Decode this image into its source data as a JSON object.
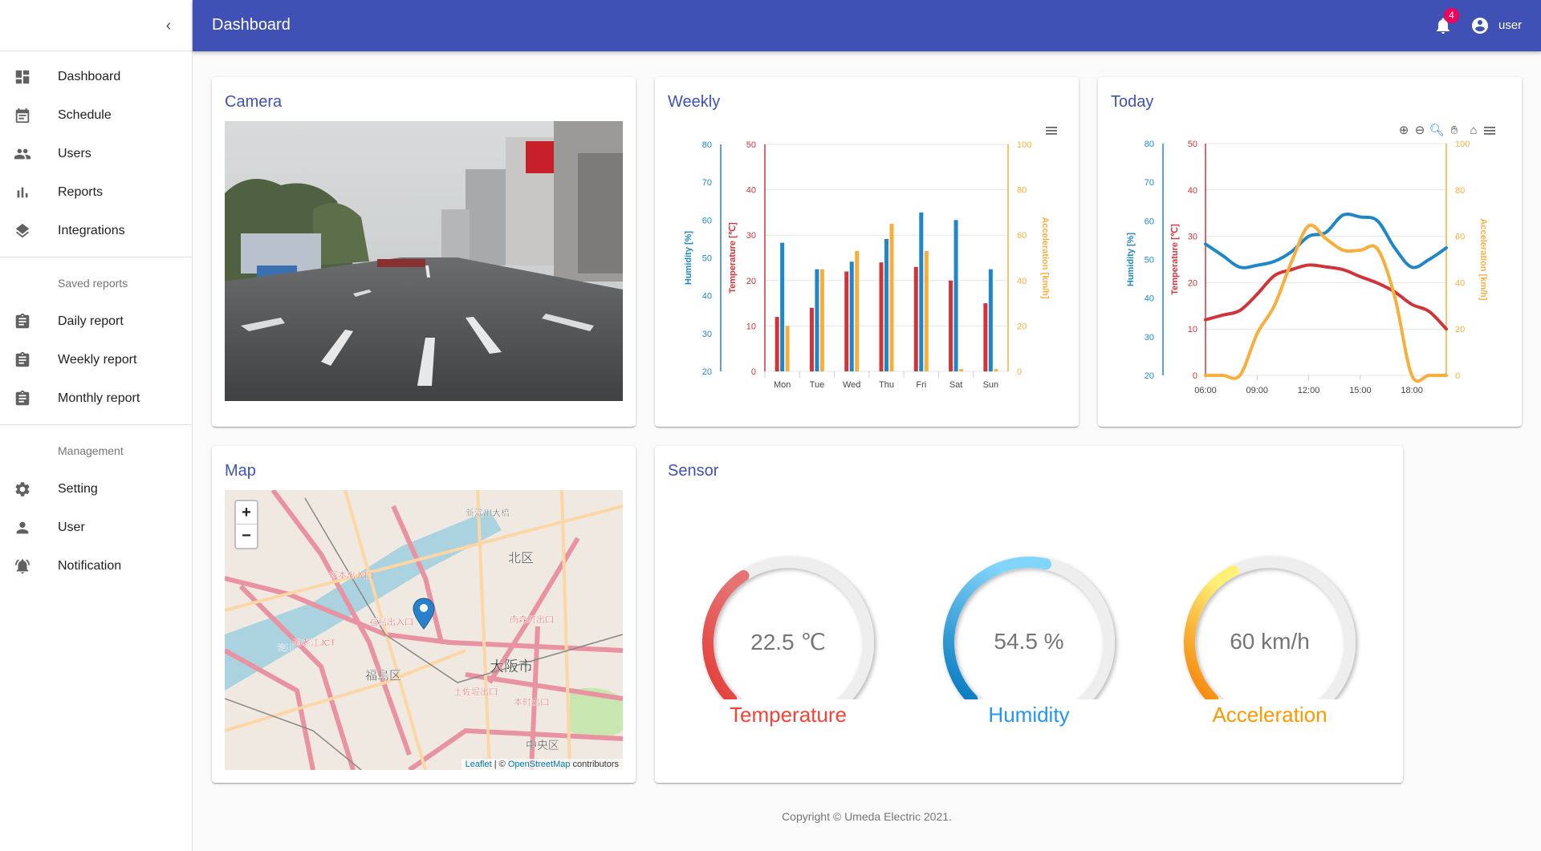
{
  "header": {
    "title": "Dashboard",
    "notification_count": "4",
    "user": "user"
  },
  "sidebar": {
    "main": [
      {
        "label": "Dashboard",
        "icon": "dashboard-icon"
      },
      {
        "label": "Schedule",
        "icon": "calendar-icon"
      },
      {
        "label": "Users",
        "icon": "people-icon"
      },
      {
        "label": "Reports",
        "icon": "bar-chart-icon"
      },
      {
        "label": "Integrations",
        "icon": "layers-icon"
      }
    ],
    "saved_title": "Saved reports",
    "saved": [
      {
        "label": "Daily report",
        "icon": "clipboard-icon"
      },
      {
        "label": "Weekly report",
        "icon": "clipboard-icon"
      },
      {
        "label": "Monthly report",
        "icon": "clipboard-icon"
      }
    ],
    "management_title": "Management",
    "management": [
      {
        "label": "Setting",
        "icon": "gear-icon"
      },
      {
        "label": "User",
        "icon": "person-icon"
      },
      {
        "label": "Notification",
        "icon": "notification-bell-icon"
      }
    ]
  },
  "cards": {
    "camera": "Camera",
    "weekly": "Weekly",
    "today": "Today",
    "map": "Map",
    "sensor": "Sensor"
  },
  "map": {
    "zoom_in": "+",
    "zoom_out": "−",
    "attribution_leaflet": "Leaflet",
    "attribution_sep": " | © ",
    "attribution_osm": "OpenStreetMap",
    "attribution_tail": " contributors",
    "labels": [
      "北区",
      "大阪市",
      "福島区",
      "中央区",
      "塚本出入口",
      "福島出入口",
      "海老江JCT",
      "新淀川大橋",
      "南森町出口",
      "土佐堀出口",
      "本町出口",
      "淀川"
    ]
  },
  "colors": {
    "primary": "#3f51b5",
    "temperature": "#d13438",
    "humidity": "#1f87c8",
    "acceleration": "#f7ae3a"
  },
  "chart_data": [
    {
      "type": "bar",
      "title": "",
      "categories": [
        "Mon",
        "Tue",
        "Wed",
        "Thu",
        "Fri",
        "Sat",
        "Sun"
      ],
      "axes": {
        "humidity": {
          "label": "Humidity [%]",
          "range": [
            20,
            80
          ],
          "ticks": [
            20,
            30,
            40,
            50,
            60,
            70,
            80
          ]
        },
        "temperature": {
          "label": "Temperature [℃]",
          "range": [
            0,
            50
          ],
          "ticks": [
            0,
            10,
            20,
            30,
            40,
            50
          ]
        },
        "acceleration": {
          "label": "Acceleration [km/h]",
          "range": [
            0,
            100
          ],
          "ticks": [
            0,
            20,
            40,
            60,
            80,
            100
          ]
        }
      },
      "series": [
        {
          "name": "Temperature",
          "axis": "temperature",
          "values": [
            12,
            14,
            22,
            24,
            23,
            20,
            15
          ]
        },
        {
          "name": "Humidity",
          "axis": "humidity",
          "values": [
            54,
            47,
            49,
            55,
            62,
            60,
            47
          ]
        },
        {
          "name": "Acceleration",
          "axis": "acceleration",
          "values": [
            20,
            45,
            53,
            65,
            53,
            1,
            1
          ]
        }
      ],
      "grid": true
    },
    {
      "type": "line",
      "title": "",
      "x": [
        "06:00",
        "07:00",
        "08:00",
        "09:00",
        "10:00",
        "11:00",
        "12:00",
        "13:00",
        "14:00",
        "15:00",
        "16:00",
        "17:00",
        "18:00",
        "19:00",
        "20:00"
      ],
      "xticks": [
        "06:00",
        "09:00",
        "12:00",
        "15:00",
        "18:00"
      ],
      "axes": {
        "humidity": {
          "label": "Humidity [%]",
          "range": [
            20,
            80
          ],
          "ticks": [
            20,
            30,
            40,
            50,
            60,
            70,
            80
          ]
        },
        "temperature": {
          "label": "Temperature [℃]",
          "range": [
            0,
            50
          ],
          "ticks": [
            0,
            10,
            20,
            30,
            40,
            50
          ]
        },
        "acceleration": {
          "label": "Acceleration [km/h]",
          "range": [
            0,
            100
          ],
          "ticks": [
            0,
            20,
            40,
            60,
            80,
            100
          ]
        }
      },
      "series": [
        {
          "name": "Humidity",
          "axis": "humidity",
          "values": [
            54,
            51,
            48,
            48.5,
            49.5,
            52,
            56,
            57,
            61.5,
            61,
            60,
            53,
            48,
            50,
            53
          ]
        },
        {
          "name": "Temperature",
          "axis": "temperature",
          "values": [
            12,
            13,
            14,
            17.5,
            21.5,
            22.8,
            23.8,
            23.4,
            22.8,
            21.3,
            19.9,
            18,
            15.3,
            13.8,
            10
          ]
        },
        {
          "name": "Acceleration",
          "axis": "acceleration",
          "values": [
            0,
            0,
            0,
            18,
            30,
            49,
            64.5,
            59,
            54,
            54,
            54.5,
            34,
            0,
            0,
            0
          ]
        }
      ],
      "grid": true
    }
  ],
  "gauges": [
    {
      "label": "Temperature",
      "value": "22.5 ℃",
      "fill_fraction": 0.375,
      "c1": "#e53935",
      "c2": "#e57373",
      "label_color": "#f44336"
    },
    {
      "label": "Humidity",
      "value": "54.5 %",
      "fill_fraction": 0.545,
      "c1": "#0277bd",
      "c2": "#81d4fa",
      "label_color": "#2196f3"
    },
    {
      "label": "Acceleration",
      "value": "60 km/h",
      "fill_fraction": 0.4,
      "c1": "#f57c00",
      "c2": "#fff176",
      "label_color": "#ff9800"
    }
  ],
  "footer": "Copyright © Umeda Electric 2021."
}
